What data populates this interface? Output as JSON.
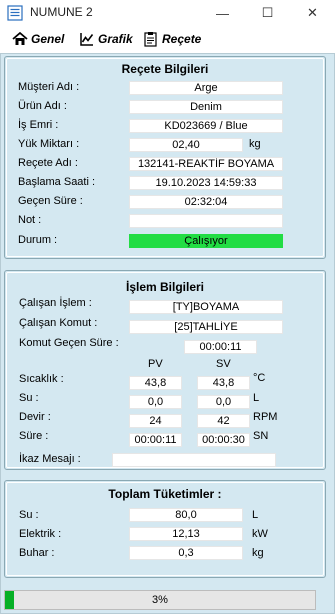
{
  "window": {
    "title": "NUMUNE 2",
    "minimize_icon": "—",
    "maximize_icon": "☐",
    "close_icon": "✕"
  },
  "toolbar": {
    "genel": "Genel",
    "grafik": "Grafik",
    "recete": "Reçete"
  },
  "recete": {
    "title": "Reçete Bilgileri",
    "rows": [
      {
        "label": "Müşteri Adı :",
        "value": "Arge",
        "unit": ""
      },
      {
        "label": "Ürün Adı :",
        "value": "Denim",
        "unit": ""
      },
      {
        "label": "İş Emri :",
        "value": "KD023669 / Blue",
        "unit": ""
      },
      {
        "label": "Yük Miktarı :",
        "value": "02,40",
        "unit": "kg"
      },
      {
        "label": "Reçete Adı :",
        "value": "132141-REAKTİF BOYAMA",
        "unit": ""
      },
      {
        "label": "Başlama Saati :",
        "value": "19.10.2023 14:59:33",
        "unit": ""
      },
      {
        "label": "Geçen Süre :",
        "value": "02:32:04",
        "unit": ""
      },
      {
        "label": "Not :",
        "value": "",
        "unit": ""
      },
      {
        "label": "Durum :",
        "value": "Çalışıyor",
        "unit": ""
      }
    ],
    "status_color": "#22dd44"
  },
  "islem": {
    "title": "İşlem Bilgileri",
    "calisan_islem_label": "Çalışan İşlem :",
    "calisan_islem_value": "[TY]BOYAMA",
    "calisan_komut_label": "Çalışan Komut :",
    "calisan_komut_value": "[25]TAHLİYE",
    "komut_gecen_sure_label": "Komut Geçen Süre :",
    "komut_gecen_sure_value": "00:00:11",
    "pv_header": "PV",
    "sv_header": "SV",
    "measurements": [
      {
        "label": "Sıcaklık :",
        "pv": "43,8",
        "sv": "43,8",
        "unit": "°C"
      },
      {
        "label": "Su :",
        "pv": "0,0",
        "sv": "0,0",
        "unit": "L"
      },
      {
        "label": "Devir :",
        "pv": "24",
        "sv": "42",
        "unit": "RPM"
      },
      {
        "label": "Süre :",
        "pv": "00:00:11",
        "sv": "00:00:30",
        "unit": "SN"
      }
    ],
    "ikaz_label": "İkaz Mesajı :",
    "ikaz_value": ""
  },
  "tuketim": {
    "title": "Toplam Tüketimler :",
    "rows": [
      {
        "label": "Su :",
        "value": "80,0",
        "unit": "L"
      },
      {
        "label": "Elektrik :",
        "value": "12,13",
        "unit": "kW"
      },
      {
        "label": "Buhar :",
        "value": "0,3",
        "unit": "kg"
      }
    ]
  },
  "progress": {
    "text": "3%",
    "fraction": 0.03,
    "color": "#06b025"
  }
}
